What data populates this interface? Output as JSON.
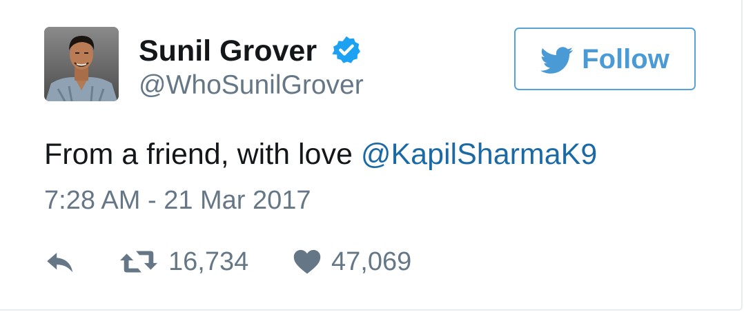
{
  "tweet": {
    "author": {
      "display_name": "Sunil Grover",
      "handle": "@WhoSunilGrover",
      "verified": true
    },
    "follow_label": "Follow",
    "text_prefix": "From a friend, with love ",
    "mention": "@KapilSharmaK9",
    "timestamp": "7:28 AM - 21 Mar 2017",
    "stats": {
      "retweets": "16,734",
      "likes": "47,069"
    }
  },
  "icons": {
    "avatar": "profile-photo",
    "verified": "verified-badge-icon",
    "follow": "twitter-bird-icon",
    "reply": "reply-icon",
    "retweet": "retweet-icon",
    "like": "heart-icon"
  },
  "colors": {
    "link": "#1b6aa5",
    "accent": "#4a9ad5",
    "verified": "#1da1f2",
    "muted": "#657786",
    "text": "#14171a"
  }
}
